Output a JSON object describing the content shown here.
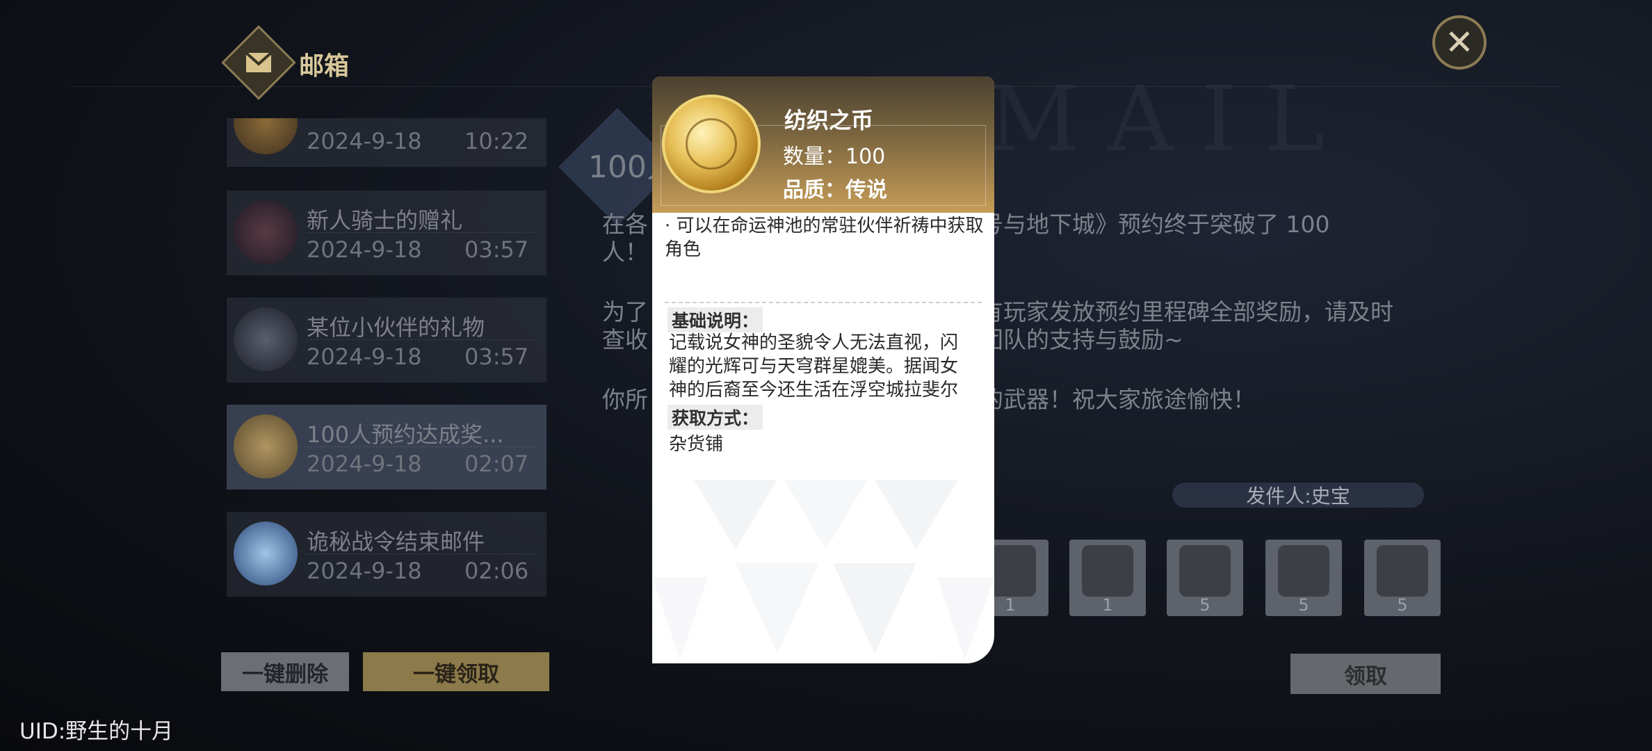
{
  "header": {
    "title": "邮箱"
  },
  "close_icon": "close-icon",
  "mail_list": [
    {
      "title": "",
      "date": "2024-9-18",
      "time": "10:22"
    },
    {
      "title": "新人骑士的赠礼",
      "date": "2024-9-18",
      "time": "03:57"
    },
    {
      "title": "某位小伙伴的礼物",
      "date": "2024-9-18",
      "time": "03:57"
    },
    {
      "title": "100人预约达成奖...",
      "date": "2024-9-18",
      "time": "02:07"
    },
    {
      "title": "诡秘战令结束邮件",
      "date": "2024-9-18",
      "time": "02:06"
    }
  ],
  "buttons": {
    "delete_all": "一键删除",
    "claim_all": "一键领取",
    "claim": "领取"
  },
  "uid": "UID:野生的十月",
  "content": {
    "title_partial": "100人",
    "line1": "在各",
    "line1_right": "号与地下城》预约终于突破了 100",
    "line2": "人！",
    "para2_left": "为了",
    "para2_right": "有玩家发放预约里程碑全部奖励，请及时",
    "para2_line2_left": "查收",
    "para2_line2_right": "团队的支持与鼓励~",
    "para3_left": "你所",
    "para3_right": "的武器！祝大家旅途愉快！",
    "sender": "发件人:史宝"
  },
  "rewards": [
    {
      "count": "1"
    },
    {
      "count": "1"
    },
    {
      "count": "5"
    },
    {
      "count": "5"
    },
    {
      "count": "5"
    }
  ],
  "popup": {
    "item_name": "纺织之币",
    "quantity": "数量：100",
    "rarity": "品质：传说",
    "desc": "· 可以在命运神池的常驻伙伴祈祷中获取角色",
    "basic_label": "基础说明：",
    "lore": "记载说女神的圣貌令人无法直视，闪耀的光辉可与天穹群星媲美。据闻女神的后裔至今还生活在浮空城拉斐尔",
    "source_label": "获取方式：",
    "source": "杂货铺"
  },
  "colors": {
    "gold": "#c79d58",
    "accent": "#8d7d55"
  }
}
